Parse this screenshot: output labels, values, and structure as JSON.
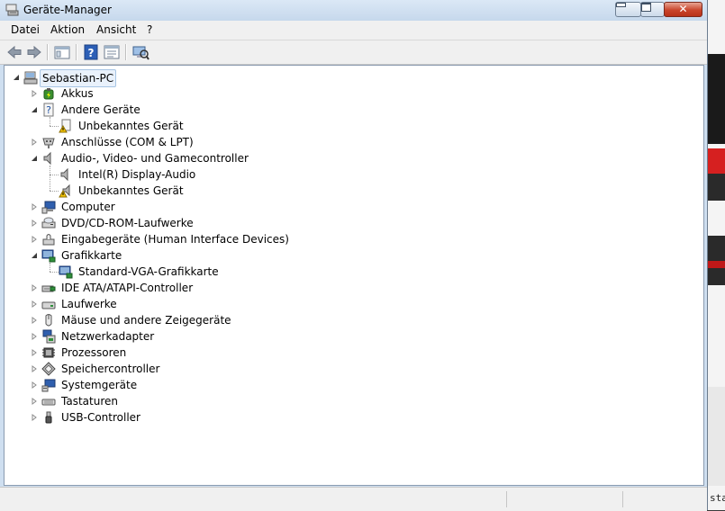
{
  "window": {
    "title": "Geräte-Manager",
    "close_symbol": "✕"
  },
  "menu": [
    "Datei",
    "Aktion",
    "Ansicht",
    "?"
  ],
  "toolbar": {
    "buttons": [
      "back-arrow-icon",
      "forward-arrow-icon",
      "console-tree-icon",
      "help-icon",
      "properties-icon",
      "scan-hardware-icon"
    ]
  },
  "tree": {
    "root": "Sebastian-PC",
    "items": [
      {
        "label": "Akkus",
        "icon": "battery-icon",
        "expanded": false
      },
      {
        "label": "Andere Geräte",
        "icon": "unknown-device-icon",
        "expanded": true,
        "children": [
          {
            "label": "Unbekanntes Gerät",
            "icon": "warning-device-icon"
          }
        ]
      },
      {
        "label": "Anschlüsse (COM & LPT)",
        "icon": "port-icon",
        "expanded": false
      },
      {
        "label": "Audio-, Video- und Gamecontroller",
        "icon": "speaker-icon",
        "expanded": true,
        "children": [
          {
            "label": "Intel(R) Display-Audio",
            "icon": "speaker-icon"
          },
          {
            "label": "Unbekanntes Gerät",
            "icon": "warning-speaker-icon"
          }
        ]
      },
      {
        "label": "Computer",
        "icon": "computer-icon",
        "expanded": false
      },
      {
        "label": "DVD/CD-ROM-Laufwerke",
        "icon": "dvd-drive-icon",
        "expanded": false
      },
      {
        "label": "Eingabegeräte (Human Interface Devices)",
        "icon": "hid-icon",
        "expanded": false
      },
      {
        "label": "Grafikkarte",
        "icon": "display-adapter-icon",
        "expanded": true,
        "children": [
          {
            "label": "Standard-VGA-Grafikkarte",
            "icon": "display-adapter-icon"
          }
        ]
      },
      {
        "label": "IDE ATA/ATAPI-Controller",
        "icon": "ide-controller-icon",
        "expanded": false
      },
      {
        "label": "Laufwerke",
        "icon": "disk-drive-icon",
        "expanded": false
      },
      {
        "label": "Mäuse und andere Zeigegeräte",
        "icon": "mouse-icon",
        "expanded": false
      },
      {
        "label": "Netzwerkadapter",
        "icon": "network-adapter-icon",
        "expanded": false
      },
      {
        "label": "Prozessoren",
        "icon": "processor-icon",
        "expanded": false
      },
      {
        "label": "Speichercontroller",
        "icon": "storage-controller-icon",
        "expanded": false
      },
      {
        "label": "Systemgeräte",
        "icon": "system-device-icon",
        "expanded": false
      },
      {
        "label": "Tastaturen",
        "icon": "keyboard-icon",
        "expanded": false
      },
      {
        "label": "USB-Controller",
        "icon": "usb-icon",
        "expanded": false
      }
    ]
  },
  "desktop_text": "sta",
  "colors": {
    "title_bg": "#c6d8ec",
    "close_button": "#c9452c",
    "selection_border": "#a7c4e3"
  }
}
